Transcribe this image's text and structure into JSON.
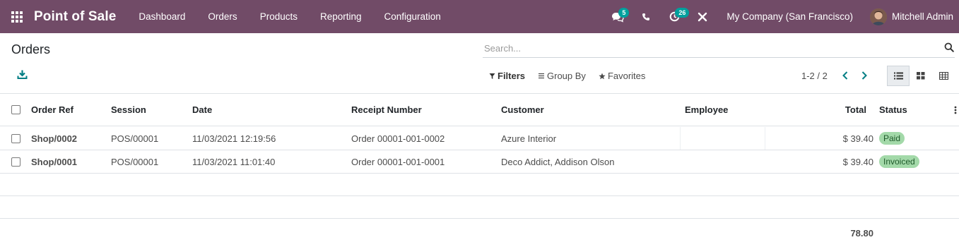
{
  "navbar": {
    "brand": "Point of Sale",
    "menu": [
      "Dashboard",
      "Orders",
      "Products",
      "Reporting",
      "Configuration"
    ],
    "messages_count": "5",
    "activities_count": "26",
    "company": "My Company (San Francisco)",
    "user": "Mitchell Admin"
  },
  "control_panel": {
    "title": "Orders",
    "search_placeholder": "Search...",
    "filters_label": "Filters",
    "groupby_label": "Group By",
    "favorites_label": "Favorites",
    "pager": "1-2 / 2"
  },
  "table": {
    "headers": {
      "order_ref": "Order Ref",
      "session": "Session",
      "date": "Date",
      "receipt": "Receipt Number",
      "customer": "Customer",
      "employee": "Employee",
      "total": "Total",
      "status": "Status"
    },
    "rows": [
      {
        "order_ref": "Shop/0002",
        "session": "POS/00001",
        "date": "11/03/2021 12:19:56",
        "receipt": "Order 00001-001-0002",
        "customer": "Azure Interior",
        "employee": "",
        "total": "$ 39.40",
        "status": "Paid"
      },
      {
        "order_ref": "Shop/0001",
        "session": "POS/00001",
        "date": "11/03/2021 11:01:40",
        "receipt": "Order 00001-001-0001",
        "customer": "Deco Addict, Addison Olson",
        "employee": "",
        "total": "$ 39.40",
        "status": "Invoiced"
      }
    ],
    "footer_total": "78.80"
  },
  "colors": {
    "navbar": "#714b67",
    "badge": "#00a09d",
    "status_badge": "#a3d9a9"
  }
}
